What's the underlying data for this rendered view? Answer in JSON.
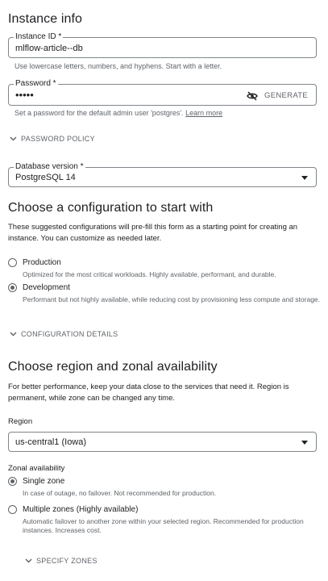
{
  "instance_info": {
    "title": "Instance info",
    "instance_id_label": "Instance ID *",
    "instance_id_value": "mlflow-article--db",
    "instance_id_hint": "Use lowercase letters, numbers, and hyphens. Start with a letter.",
    "password_label": "Password *",
    "password_value": "•••••",
    "generate_label": "GENERATE",
    "password_hint": "Set a password for the default admin user 'postgres'.",
    "learn_more": "Learn more",
    "password_policy": "PASSWORD POLICY",
    "db_version_label": "Database version *",
    "db_version_value": "PostgreSQL 14"
  },
  "configuration": {
    "title": "Choose a configuration to start with",
    "description": "These suggested configurations will pre-fill this form as a starting point for creating an instance. You can customize as needed later.",
    "options": [
      {
        "label": "Production",
        "desc": "Optimized for the most critical workloads. Highly available, performant, and durable.",
        "checked": false
      },
      {
        "label": "Development",
        "desc": "Performant but not highly available, while reducing cost by provisioning less compute and storage.",
        "checked": true
      }
    ],
    "details_label": "CONFIGURATION DETAILS"
  },
  "region": {
    "title": "Choose region and zonal availability",
    "description": "For better performance, keep your data close to the services that need it. Region is permanent, while zone can be changed any time.",
    "region_label": "Region",
    "region_value": "us-central1 (Iowa)",
    "zonal_label": "Zonal availability",
    "options": [
      {
        "label": "Single zone",
        "desc": "In case of outage, no failover. Not recommended for production.",
        "checked": true
      },
      {
        "label": "Multiple zones (Highly available)",
        "desc": "Automatic failover to another zone within your selected region. Recommended for production instances. Increases cost.",
        "checked": false
      }
    ],
    "specify_zones": "SPECIFY ZONES"
  }
}
